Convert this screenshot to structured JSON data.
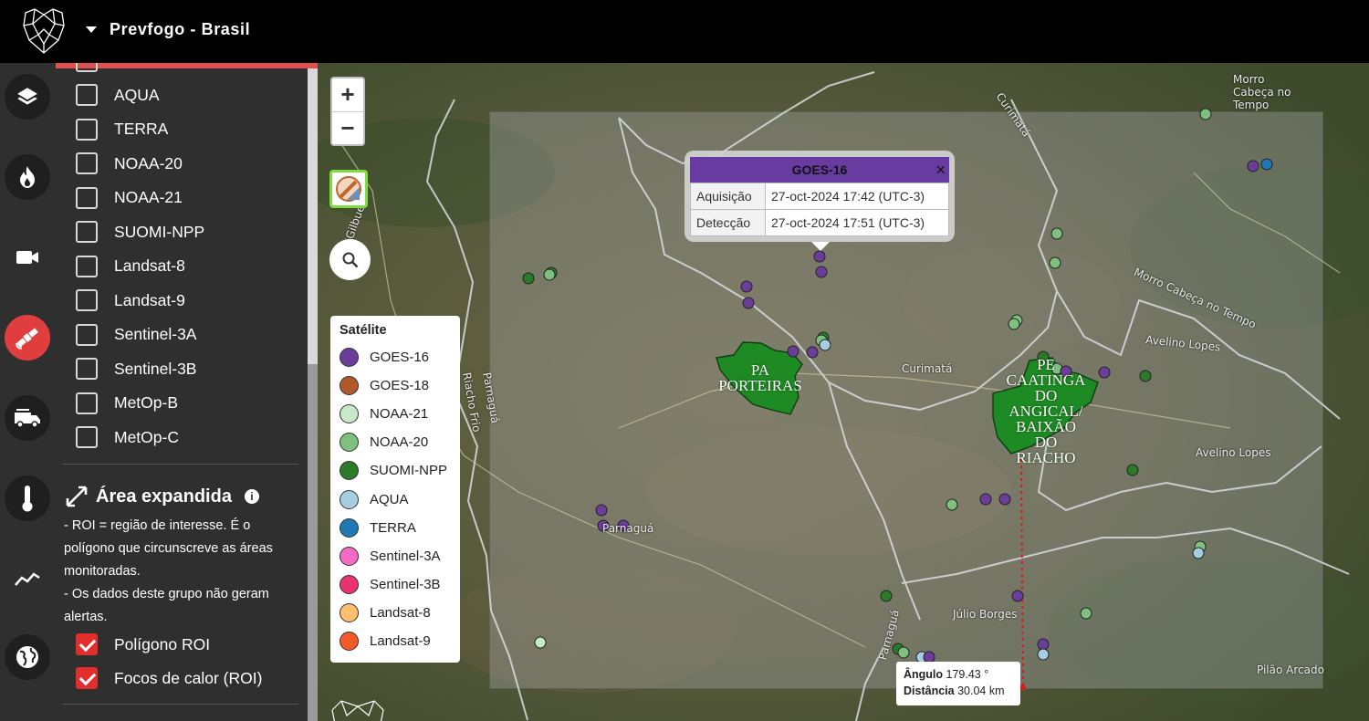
{
  "app": {
    "title": "Prevfogo - Brasil",
    "logo_icon": "jaguar-logo-icon"
  },
  "rail": {
    "items": [
      {
        "name": "layers",
        "icon": "layers-icon"
      },
      {
        "name": "fire",
        "icon": "fire-icon"
      },
      {
        "name": "camera",
        "icon": "video-camera-icon"
      },
      {
        "name": "satellite",
        "icon": "satellite-icon",
        "active": true
      },
      {
        "name": "fire-truck",
        "icon": "fire-truck-icon"
      },
      {
        "name": "temperature",
        "icon": "thermometer-icon"
      },
      {
        "name": "trend",
        "icon": "trend-line-icon"
      },
      {
        "name": "globe",
        "icon": "globe-icon"
      }
    ]
  },
  "panel": {
    "satellites": [
      "AQUA",
      "TERRA",
      "NOAA-20",
      "NOAA-21",
      "SUOMI-NPP",
      "Landsat-8",
      "Landsat-9",
      "Sentinel-3A",
      "Sentinel-3B",
      "MetOp-B",
      "MetOp-C"
    ],
    "expanded": {
      "title": "Área expandida",
      "desc1": "- ROI = região de interesse. É o polígono que circunscreve as áreas monitoradas.",
      "desc2": "- Os dados deste grupo não geram alertas.",
      "opt1": "Polígono ROI",
      "opt2": "Focos de calor (ROI)"
    }
  },
  "map": {
    "zoom_in": "+",
    "zoom_out": "−",
    "legend": {
      "title": "Satélite",
      "items": [
        {
          "label": "GOES-16",
          "color": "#6a3d9a"
        },
        {
          "label": "GOES-18",
          "color": "#b05a2a"
        },
        {
          "label": "NOAA-21",
          "color": "#c9e8c9"
        },
        {
          "label": "NOAA-20",
          "color": "#7fc07f"
        },
        {
          "label": "SUOMI-NPP",
          "color": "#2a7a2a"
        },
        {
          "label": "AQUA",
          "color": "#a6cee3"
        },
        {
          "label": "TERRA",
          "color": "#1f78b4"
        },
        {
          "label": "Sentinel-3A",
          "color": "#f36bc4"
        },
        {
          "label": "Sentinel-3B",
          "color": "#e8336e"
        },
        {
          "label": "Landsat-8",
          "color": "#fdbf6f"
        },
        {
          "label": "Landsat-9",
          "color": "#f25a28"
        }
      ]
    },
    "popup": {
      "title": "GOES-16",
      "close": "×",
      "row1_key": "Aquisição",
      "row1_val": "27-oct-2024 17:42 (UTC-3)",
      "row2_key": "Detecção",
      "row2_val": "27-oct-2024 17:51 (UTC-3)"
    },
    "measure": {
      "angle_label": "Ângulo",
      "angle_val": "179.43 °",
      "dist_label": "Distância",
      "dist_val": "30.04 km"
    },
    "areas": {
      "a1": "PA\nPORTEIRAS",
      "a2": "PE\nCAATINGA\nDO\nANGICAL/\nBAIXÃO\nDO\nRIACHO"
    },
    "labels": {
      "curimata_town": "Curimatá",
      "parnagua_town": "Parnaguá",
      "avelino_town": "Avelino Lopes",
      "julio_town": "Júlio Borges",
      "pilao": "Pilão Arcado",
      "morro1": "Morro",
      "morro2": "Cabeça no",
      "morro3": "Tempo",
      "road_morro": "Morro Cabeça no Tempo",
      "road_avelino": "Avelino Lopes",
      "road_curimata": "Curimatá",
      "road_parnagua": "Parnaguá",
      "road_riacho": "Riacho Frio",
      "road_gilbues": "Gilbués",
      "road_parnagua2": "Parnaguá"
    }
  }
}
